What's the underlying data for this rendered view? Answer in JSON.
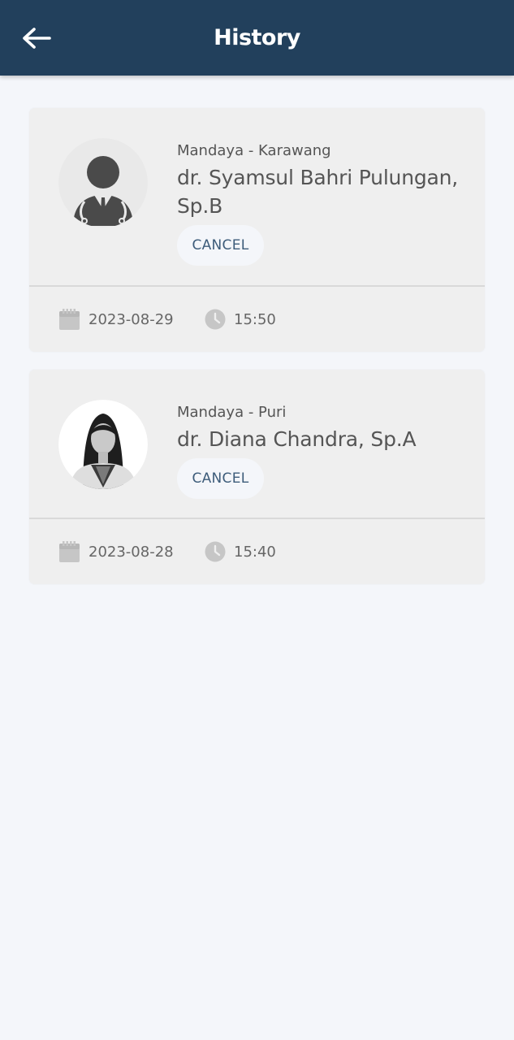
{
  "header": {
    "title": "History",
    "back_icon": "arrow-left-icon",
    "background_color": "#22405c"
  },
  "appointments": [
    {
      "hospital": "Mandaya - Karawang",
      "doctor": "dr. Syamsul Bahri Pulungan, Sp.B",
      "avatar": "default-doctor-avatar",
      "cancel_label": "CANCEL",
      "date": "2023-08-29",
      "time": "15:50"
    },
    {
      "hospital": "Mandaya - Puri",
      "doctor": "dr. Diana Chandra, Sp.A",
      "avatar": "doctor-photo",
      "cancel_label": "CANCEL",
      "date": "2023-08-28",
      "time": "15:40"
    }
  ],
  "icons": {
    "date": "calendar-icon",
    "time": "clock-icon"
  }
}
